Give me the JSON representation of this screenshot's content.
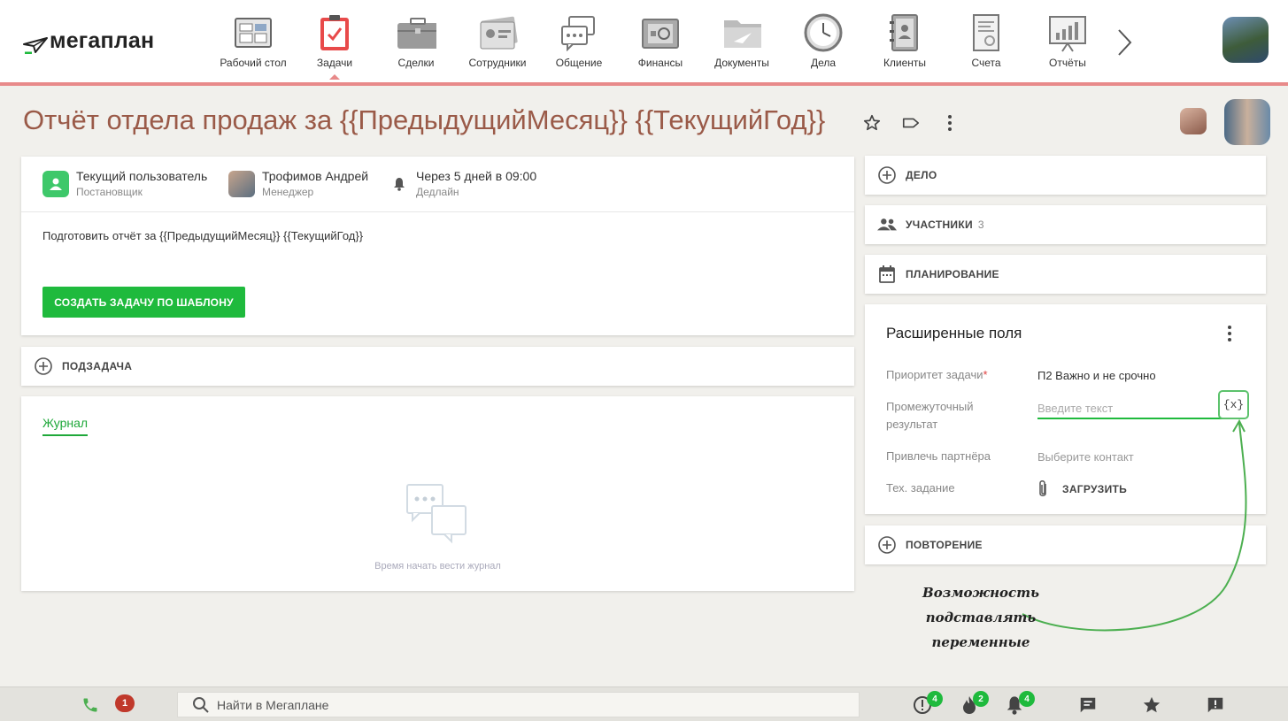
{
  "app": {
    "logo_text": "мегаплан"
  },
  "nav": {
    "items": [
      {
        "label": "Рабочий стол",
        "icon": "dashboard-icon"
      },
      {
        "label": "Задачи",
        "icon": "tasks-clipboard-icon"
      },
      {
        "label": "Сделки",
        "icon": "briefcase-icon"
      },
      {
        "label": "Сотрудники",
        "icon": "employees-card-icon"
      },
      {
        "label": "Общение",
        "icon": "chat-bubbles-icon"
      },
      {
        "label": "Финансы",
        "icon": "safe-icon"
      },
      {
        "label": "Документы",
        "icon": "folder-icon"
      },
      {
        "label": "Дела",
        "icon": "clock-icon"
      },
      {
        "label": "Клиенты",
        "icon": "address-book-icon"
      },
      {
        "label": "Счета",
        "icon": "invoice-icon"
      },
      {
        "label": "Отчёты",
        "icon": "report-chart-icon"
      }
    ],
    "active_index": 1,
    "accent_color": "#e88a8a"
  },
  "task": {
    "title": "Отчёт отдела продаж за {{ПредыдущийМесяц}} {{ТекущийГод}}",
    "owner": {
      "name": "Текущий пользователь",
      "role": "Постановщик"
    },
    "manager": {
      "name": "Трофимов Андрей",
      "role": "Менеджер"
    },
    "deadline": {
      "text": "Через 5 дней в 09:00",
      "label": "Дедлайн"
    },
    "description": "Подготовить отчёт за {{ПредыдущийМесяц}} {{ТекущийГод}}",
    "create_button": "СОЗДАТЬ ЗАДАЧУ ПО ШАБЛОНУ"
  },
  "subtask": {
    "label": "ПОДЗАДАЧА"
  },
  "journal": {
    "tab": "Журнал",
    "empty_text": "Время начать вести журнал"
  },
  "side": {
    "deal": {
      "label": "ДЕЛО"
    },
    "participants": {
      "label": "УЧАСТНИКИ",
      "count": "3"
    },
    "planning": {
      "label": "ПЛАНИРОВАНИЕ"
    },
    "repeat": {
      "label": "ПОВТОРЕНИЕ"
    }
  },
  "extended": {
    "title": "Расширенные поля",
    "priority": {
      "label": "Приоритет задачи",
      "required_mark": "*",
      "value": "П2 Важно и не срочно"
    },
    "intermediate": {
      "label_line1": "Промежуточный",
      "label_line2": "результат",
      "placeholder": "Введите текст",
      "var_button": "{x}"
    },
    "partner": {
      "label": "Привлечь партнёра",
      "placeholder": "Выберите контакт"
    },
    "spec": {
      "label": "Тех. задание",
      "upload": "ЗАГРУЗИТЬ"
    }
  },
  "annotation": {
    "line1": "Возможность подставлять",
    "line2": "переменные"
  },
  "bottombar": {
    "phone_badge": "1",
    "search_placeholder": "Найти в Мегаплане",
    "alerts_badge": "4",
    "hot_badge": "2",
    "notifications_badge": "4"
  }
}
